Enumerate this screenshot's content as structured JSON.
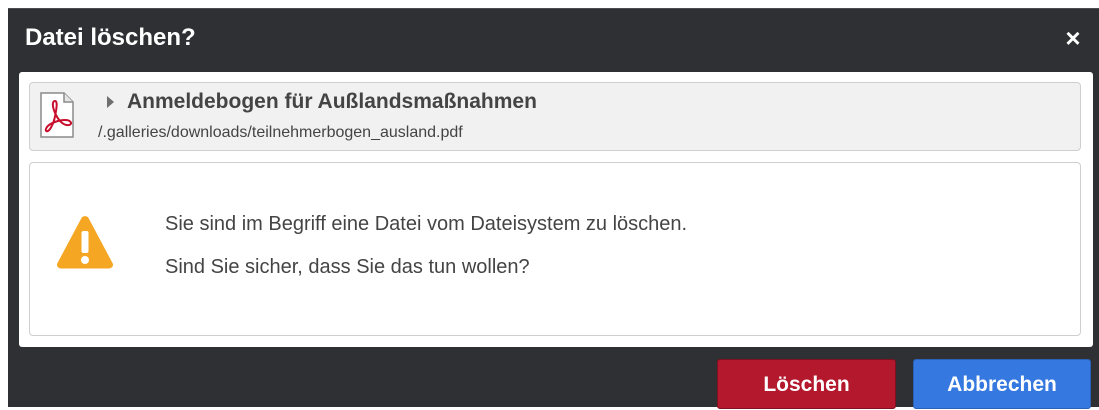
{
  "dialog": {
    "title": "Datei löschen?",
    "close_glyph": "×"
  },
  "file": {
    "icon": "pdf-file-icon",
    "name": "Anmeldebogen für Außlandsmaßnahmen",
    "path": "/.galleries/downloads/teilnehmerbogen_ausland.pdf"
  },
  "message": {
    "icon": "warning-icon",
    "line1": "Sie sind im Begriff eine Datei vom Dateisystem zu löschen.",
    "line2": "Sind Sie sicher, dass Sie das tun wollen?"
  },
  "buttons": {
    "delete_label": "Löschen",
    "cancel_label": "Abbrechen"
  },
  "colors": {
    "dialog_background": "#2e3033",
    "delete_button": "#b3182d",
    "cancel_button": "#3478e0",
    "warning": "#f5a623",
    "pdf_red": "#c8102e"
  }
}
